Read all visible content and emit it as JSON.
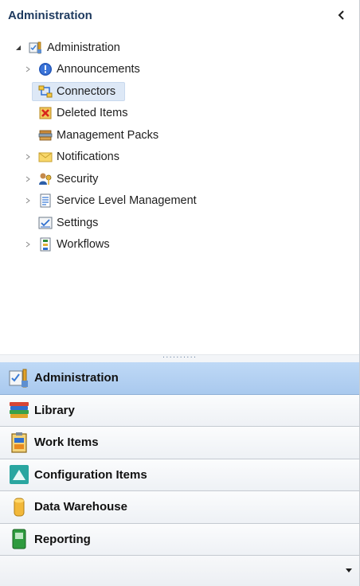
{
  "header": {
    "title": "Administration"
  },
  "tree": {
    "root": {
      "label": "Administration",
      "icon": "admin-folder-icon"
    },
    "items": [
      {
        "label": "Announcements",
        "icon": "info-icon",
        "expandable": true
      },
      {
        "label": "Connectors",
        "icon": "connectors-icon",
        "expandable": false,
        "selected": true
      },
      {
        "label": "Deleted Items",
        "icon": "deleted-items-icon",
        "expandable": false
      },
      {
        "label": "Management Packs",
        "icon": "management-packs-icon",
        "expandable": false
      },
      {
        "label": "Notifications",
        "icon": "envelope-icon",
        "expandable": true
      },
      {
        "label": "Security",
        "icon": "security-users-icon",
        "expandable": true
      },
      {
        "label": "Service Level Management",
        "icon": "document-icon",
        "expandable": true
      },
      {
        "label": "Settings",
        "icon": "settings-check-icon",
        "expandable": false
      },
      {
        "label": "Workflows",
        "icon": "workflows-icon",
        "expandable": true
      }
    ]
  },
  "nav": {
    "buttons": [
      {
        "label": "Administration",
        "icon": "administration-nav-icon",
        "active": true
      },
      {
        "label": "Library",
        "icon": "books-icon",
        "active": false
      },
      {
        "label": "Work Items",
        "icon": "work-items-icon",
        "active": false
      },
      {
        "label": "Configuration Items",
        "icon": "configuration-items-icon",
        "active": false
      },
      {
        "label": "Data Warehouse",
        "icon": "data-warehouse-icon",
        "active": false
      },
      {
        "label": "Reporting",
        "icon": "reporting-book-icon",
        "active": false
      }
    ]
  },
  "colors": {
    "accent_active": "#a9c9ee",
    "selected_row": "#dde8f6",
    "header_text": "#1e3a5f"
  }
}
